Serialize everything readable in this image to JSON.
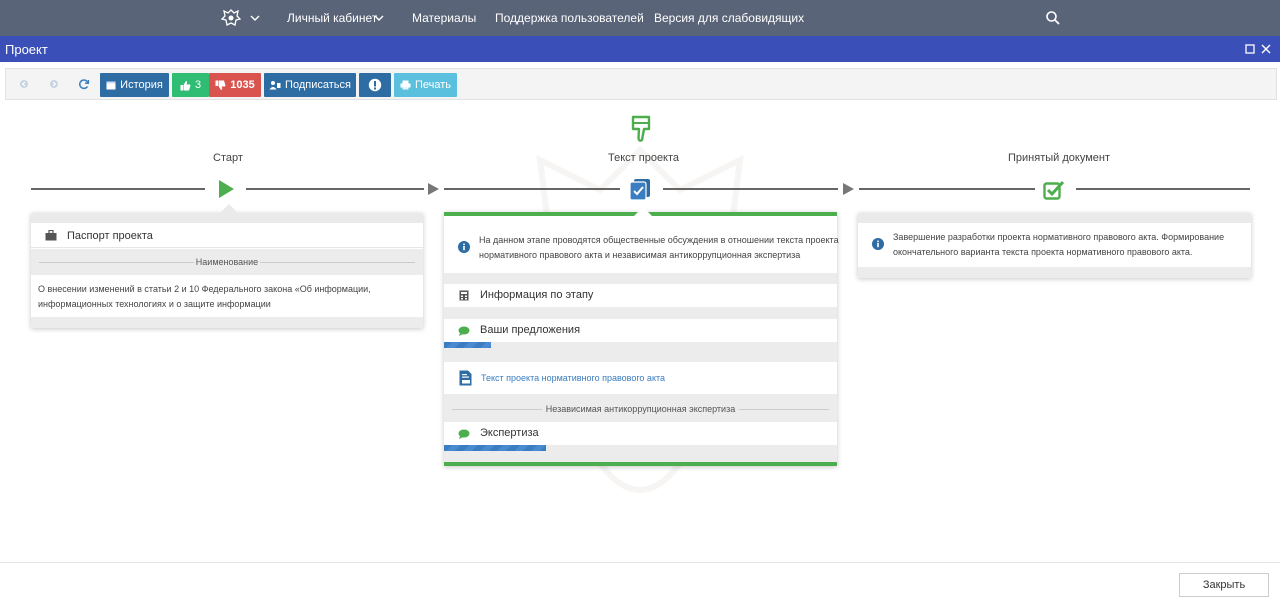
{
  "topnav": {
    "emblem_icon": "coat-of-arms-icon",
    "items": [
      "Личный кабинет",
      "Материалы",
      "Поддержка пользователей",
      "Версия для слабовидящих"
    ]
  },
  "window": {
    "title": "Проект"
  },
  "toolbar": {
    "history": "История",
    "likes": "3",
    "dislikes": "1035",
    "subscribe": "Подписаться",
    "print": "Печать"
  },
  "timeline": {
    "stages": [
      "Старт",
      "Текст проекта",
      "Принятый документ"
    ]
  },
  "start_card": {
    "passport": "Паспорт проекта",
    "name_section": "Наименование",
    "description_line1": "О внесении изменений в статьи 2 и 10 Федерального закона «Об информации,",
    "description_line2": "информационных технологиях и о защите информации"
  },
  "text_card": {
    "info_line1": "На данном этапе проводятся общественные обсуждения в отношении текста проекта",
    "info_line2": "нормативного правового акта и независимая антикоррупционная экспертиза",
    "stage_info": "Информация по этапу",
    "proposals": "Ваши предложения",
    "proposals_progress": 0.12,
    "doc_link": "Текст проекта нормативного правового акта",
    "expertise_section": "Независимая антикоррупционная экспертиза",
    "expertise": "Экспертиза",
    "expertise_progress": 0.26
  },
  "final_card": {
    "info_line1": "Завершение разработки проекта нормативного правового акта. Формирование",
    "info_line2": "окончательного варианта текста проекта нормативного правового акта."
  },
  "footer": {
    "close": "Закрыть"
  },
  "colors": {
    "nav_bg": "#5a6478",
    "title_bar": "#3b4fb8",
    "btn_blue": "#2e6da4",
    "btn_green": "#2fbc73",
    "btn_red": "#d9534f",
    "btn_light": "#5bc0de",
    "accent_green": "#4cae4c",
    "link": "#3a7dc0"
  }
}
